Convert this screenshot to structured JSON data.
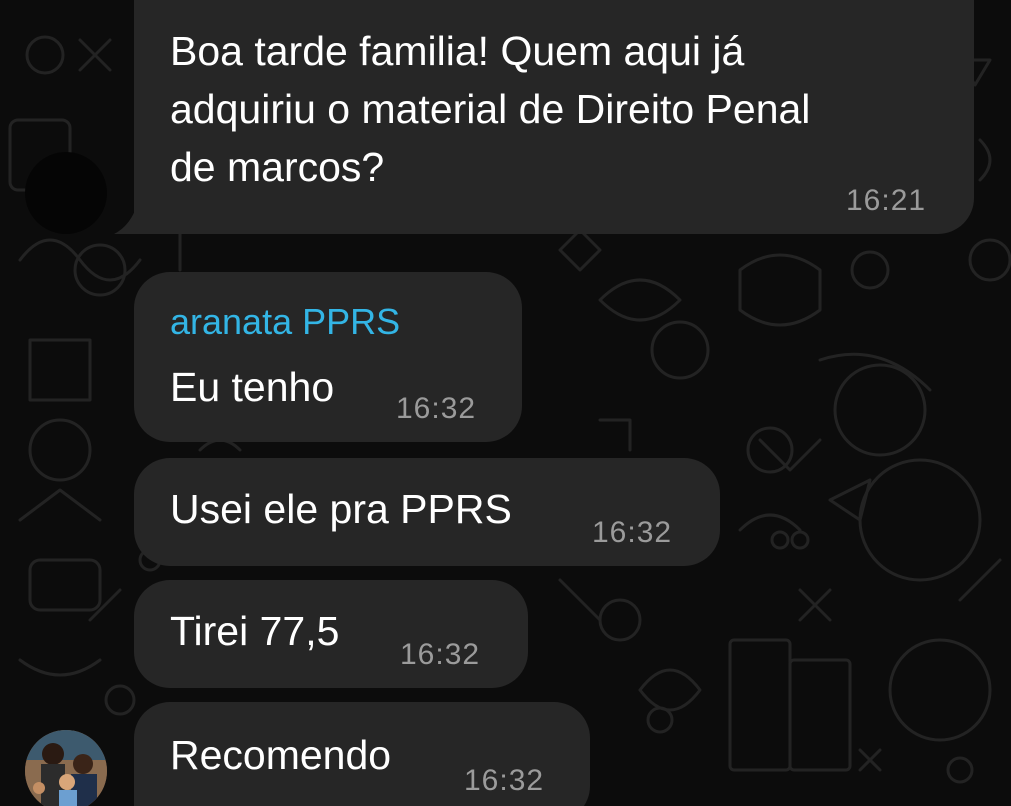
{
  "colors": {
    "background": "#0c0c0c",
    "bubble": "#262626",
    "text": "#ffffff",
    "time": "#9b9b9b",
    "sender_name": "#33b5e5"
  },
  "messages": [
    {
      "text": "Boa tarde familia! Quem aqui já\nadquiriu o material de Direito Penal\nde marcos?",
      "time": "16:21"
    },
    {
      "sender": "aranata PPRS",
      "text": "Eu tenho",
      "time": "16:32"
    },
    {
      "text": "Usei ele pra PPRS",
      "time": "16:32"
    },
    {
      "text": "Tirei 77,5",
      "time": "16:32"
    },
    {
      "text": "Recomendo",
      "time": "16:32"
    }
  ]
}
